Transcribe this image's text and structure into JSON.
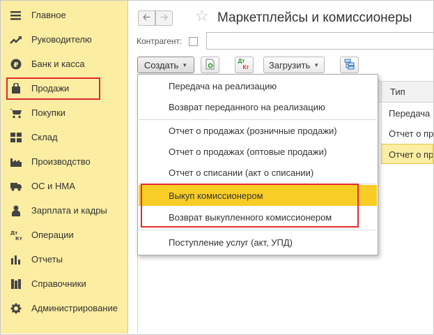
{
  "page": {
    "title": "Маркетплейсы и комиссионеры"
  },
  "sidebar": {
    "items": [
      {
        "label": "Главное",
        "icon": "menu-lines-icon"
      },
      {
        "label": "Руководителю",
        "icon": "trend-chart-icon"
      },
      {
        "label": "Банк и касса",
        "icon": "ruble-coin-icon"
      },
      {
        "label": "Продажи",
        "icon": "shopping-bag-icon"
      },
      {
        "label": "Покупки",
        "icon": "shopping-cart-icon"
      },
      {
        "label": "Склад",
        "icon": "warehouse-grid-icon"
      },
      {
        "label": "Производство",
        "icon": "factory-icon"
      },
      {
        "label": "ОС и НМА",
        "icon": "truck-icon"
      },
      {
        "label": "Зарплата и кадры",
        "icon": "person-icon"
      },
      {
        "label": "Операции",
        "icon": "dt-kt-icon"
      },
      {
        "label": "Отчеты",
        "icon": "bar-chart-icon"
      },
      {
        "label": "Справочники",
        "icon": "books-icon"
      },
      {
        "label": "Администрирование",
        "icon": "gear-icon"
      }
    ],
    "highlighted": "Продажи"
  },
  "toolbar": {
    "back_icon": "arrow-left-icon",
    "forward_icon": "arrow-right-icon",
    "favorite_icon": "star-icon",
    "kontragent_label": "Контрагент:",
    "create_label": "Создать",
    "load_label": "Загрузить",
    "dtkt_top": "Дт",
    "dtkt_bottom": "Кт"
  },
  "table": {
    "column_header": "Тип",
    "rows": [
      "Передача",
      "Отчет о пр",
      "Отчет о пр"
    ],
    "selected_row": 2
  },
  "menu": {
    "items": [
      "Передача на реализацию",
      "Возврат переданного на реализацию",
      "Отчет о продажах (розничные продажи)",
      "Отчет о продажах (оптовые продажи)",
      "Отчет о списании (акт о списании)",
      "Выкуп комиссионером",
      "Возврат выкупленного комиссионером",
      "Поступление услуг (акт, УПД)"
    ],
    "active_item": "Выкуп комиссионером",
    "highlight_color": "#f7cd26",
    "annotation_color": "#e3292f"
  },
  "colors": {
    "sidebar_bg": "#fbeda1",
    "accent_red": "#e3292f",
    "active_yellow": "#f7cd26"
  }
}
